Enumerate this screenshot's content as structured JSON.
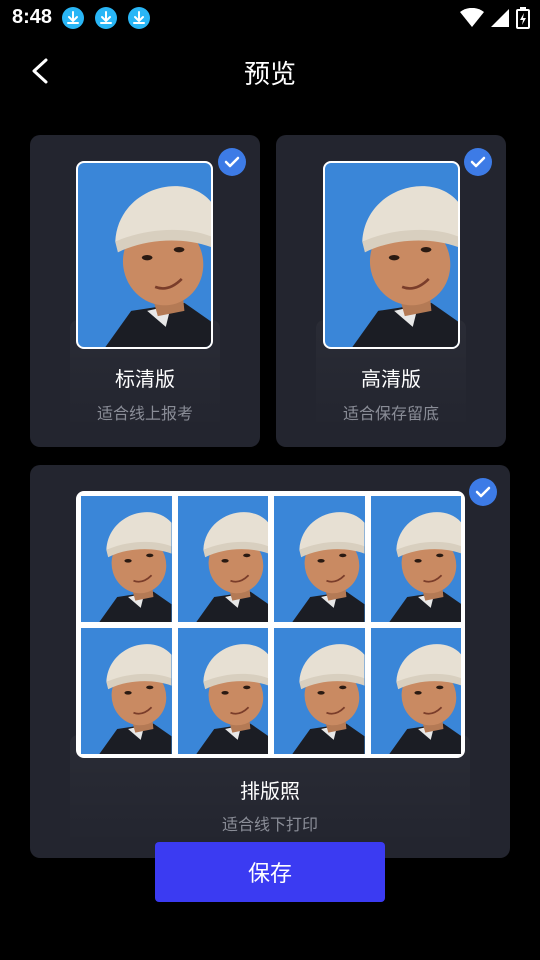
{
  "status_bar": {
    "time": "8:48",
    "download_icons": [
      "download-icon",
      "download-icon",
      "download-icon"
    ],
    "accent": "#29b6f6"
  },
  "header": {
    "title": "预览",
    "back_icon": "back-arrow-icon"
  },
  "options": [
    {
      "label": "标清版",
      "subtitle": "适合线上报考",
      "selected": true
    },
    {
      "label": "高清版",
      "subtitle": "适合保存留底",
      "selected": true
    },
    {
      "label": "排版照",
      "subtitle": "适合线下打印",
      "selected": true
    }
  ],
  "layout_grid": {
    "rows": 2,
    "cols": 4
  },
  "save_button": {
    "label": "保存",
    "color": "#3b3bf2"
  },
  "colors": {
    "card": "#23252f",
    "check": "#3d7be6",
    "photo_bg": "#3a86d8"
  }
}
